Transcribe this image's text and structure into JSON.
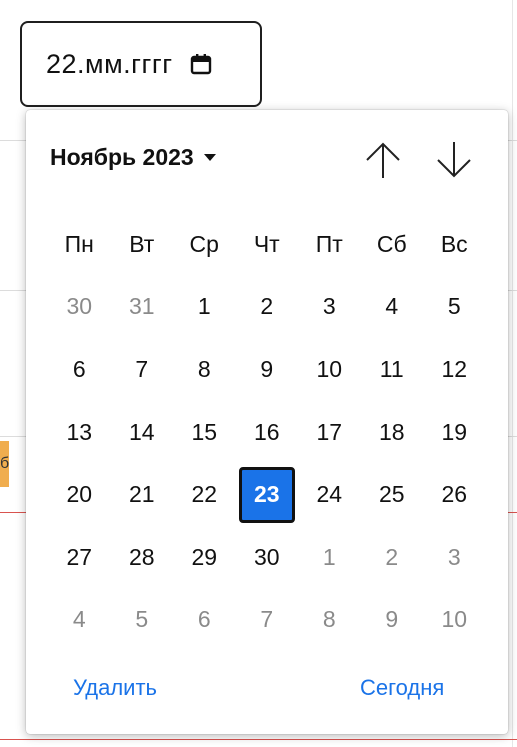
{
  "date_input": {
    "value": "22.мм.гггг"
  },
  "calendar": {
    "month_label": "Ноябрь 2023",
    "weekdays": [
      "Пн",
      "Вт",
      "Ср",
      "Чт",
      "Пт",
      "Сб",
      "Вс"
    ],
    "weeks": [
      [
        {
          "d": "30",
          "other": true
        },
        {
          "d": "31",
          "other": true
        },
        {
          "d": "1"
        },
        {
          "d": "2"
        },
        {
          "d": "3"
        },
        {
          "d": "4"
        },
        {
          "d": "5"
        }
      ],
      [
        {
          "d": "6"
        },
        {
          "d": "7"
        },
        {
          "d": "8"
        },
        {
          "d": "9"
        },
        {
          "d": "10"
        },
        {
          "d": "11"
        },
        {
          "d": "12"
        }
      ],
      [
        {
          "d": "13"
        },
        {
          "d": "14"
        },
        {
          "d": "15"
        },
        {
          "d": "16"
        },
        {
          "d": "17"
        },
        {
          "d": "18"
        },
        {
          "d": "19"
        }
      ],
      [
        {
          "d": "20"
        },
        {
          "d": "21"
        },
        {
          "d": "22"
        },
        {
          "d": "23",
          "selected": true
        },
        {
          "d": "24"
        },
        {
          "d": "25"
        },
        {
          "d": "26"
        }
      ],
      [
        {
          "d": "27"
        },
        {
          "d": "28"
        },
        {
          "d": "29"
        },
        {
          "d": "30"
        },
        {
          "d": "1",
          "other": true
        },
        {
          "d": "2",
          "other": true
        },
        {
          "d": "3",
          "other": true
        }
      ],
      [
        {
          "d": "4",
          "other": true
        },
        {
          "d": "5",
          "other": true
        },
        {
          "d": "6",
          "other": true
        },
        {
          "d": "7",
          "other": true
        },
        {
          "d": "8",
          "other": true
        },
        {
          "d": "9",
          "other": true
        },
        {
          "d": "10",
          "other": true
        }
      ]
    ],
    "clear_label": "Удалить",
    "today_label": "Сегодня"
  },
  "background": {
    "tag_text": "б"
  },
  "colors": {
    "accent": "#1a73e8",
    "selected_bg": "#1a73e8",
    "other_month": "#8a8a8a"
  },
  "icons": {
    "input_icon": "calendar-icon",
    "prev": "arrow-up-icon",
    "next": "arrow-down-icon",
    "month_menu": "caret-down-icon"
  }
}
